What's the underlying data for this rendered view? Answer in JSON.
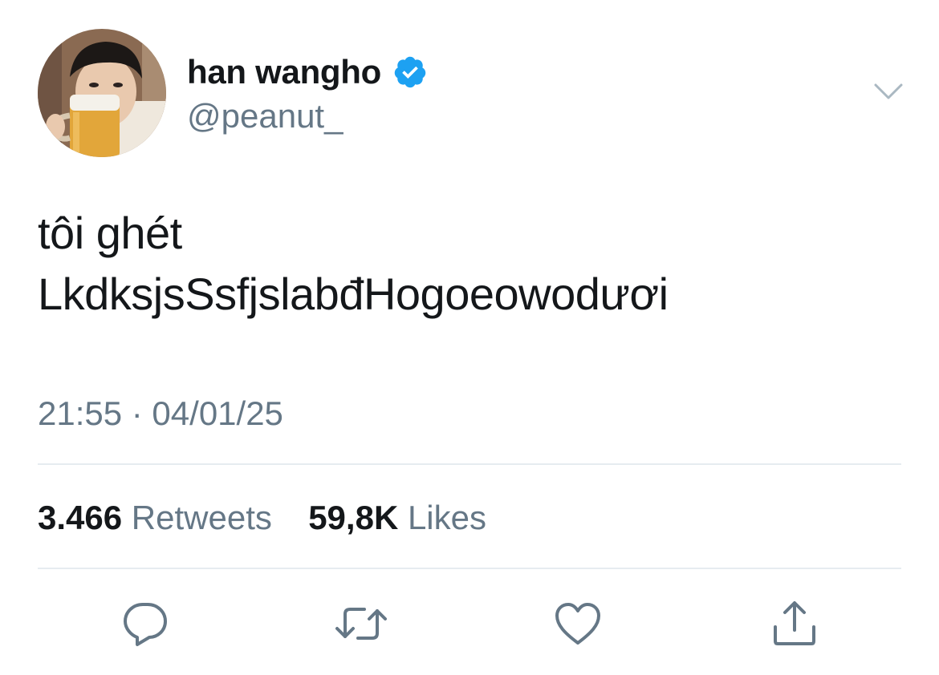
{
  "tweet": {
    "author": {
      "display_name": "han wangho",
      "handle": "@peanut_",
      "verified": true
    },
    "text_lines": [
      "tôi ghét",
      "LkdksjsSsfjslabđHogoeowodươi"
    ],
    "timestamp": "21:55 · 04/01/25",
    "stats": {
      "retweets_count": "3.466",
      "retweets_label": "Retweets",
      "likes_count": "59,8K",
      "likes_label": "Likes"
    }
  },
  "icons": {
    "verified": "verified-badge-icon",
    "menu": "chevron-down-icon",
    "reply": "reply-icon",
    "retweet": "retweet-icon",
    "like": "heart-icon",
    "share": "share-icon"
  },
  "colors": {
    "text_primary": "#14171a",
    "text_secondary": "#657786",
    "verified_blue": "#1da1f2",
    "divider": "#e6ecf0"
  }
}
